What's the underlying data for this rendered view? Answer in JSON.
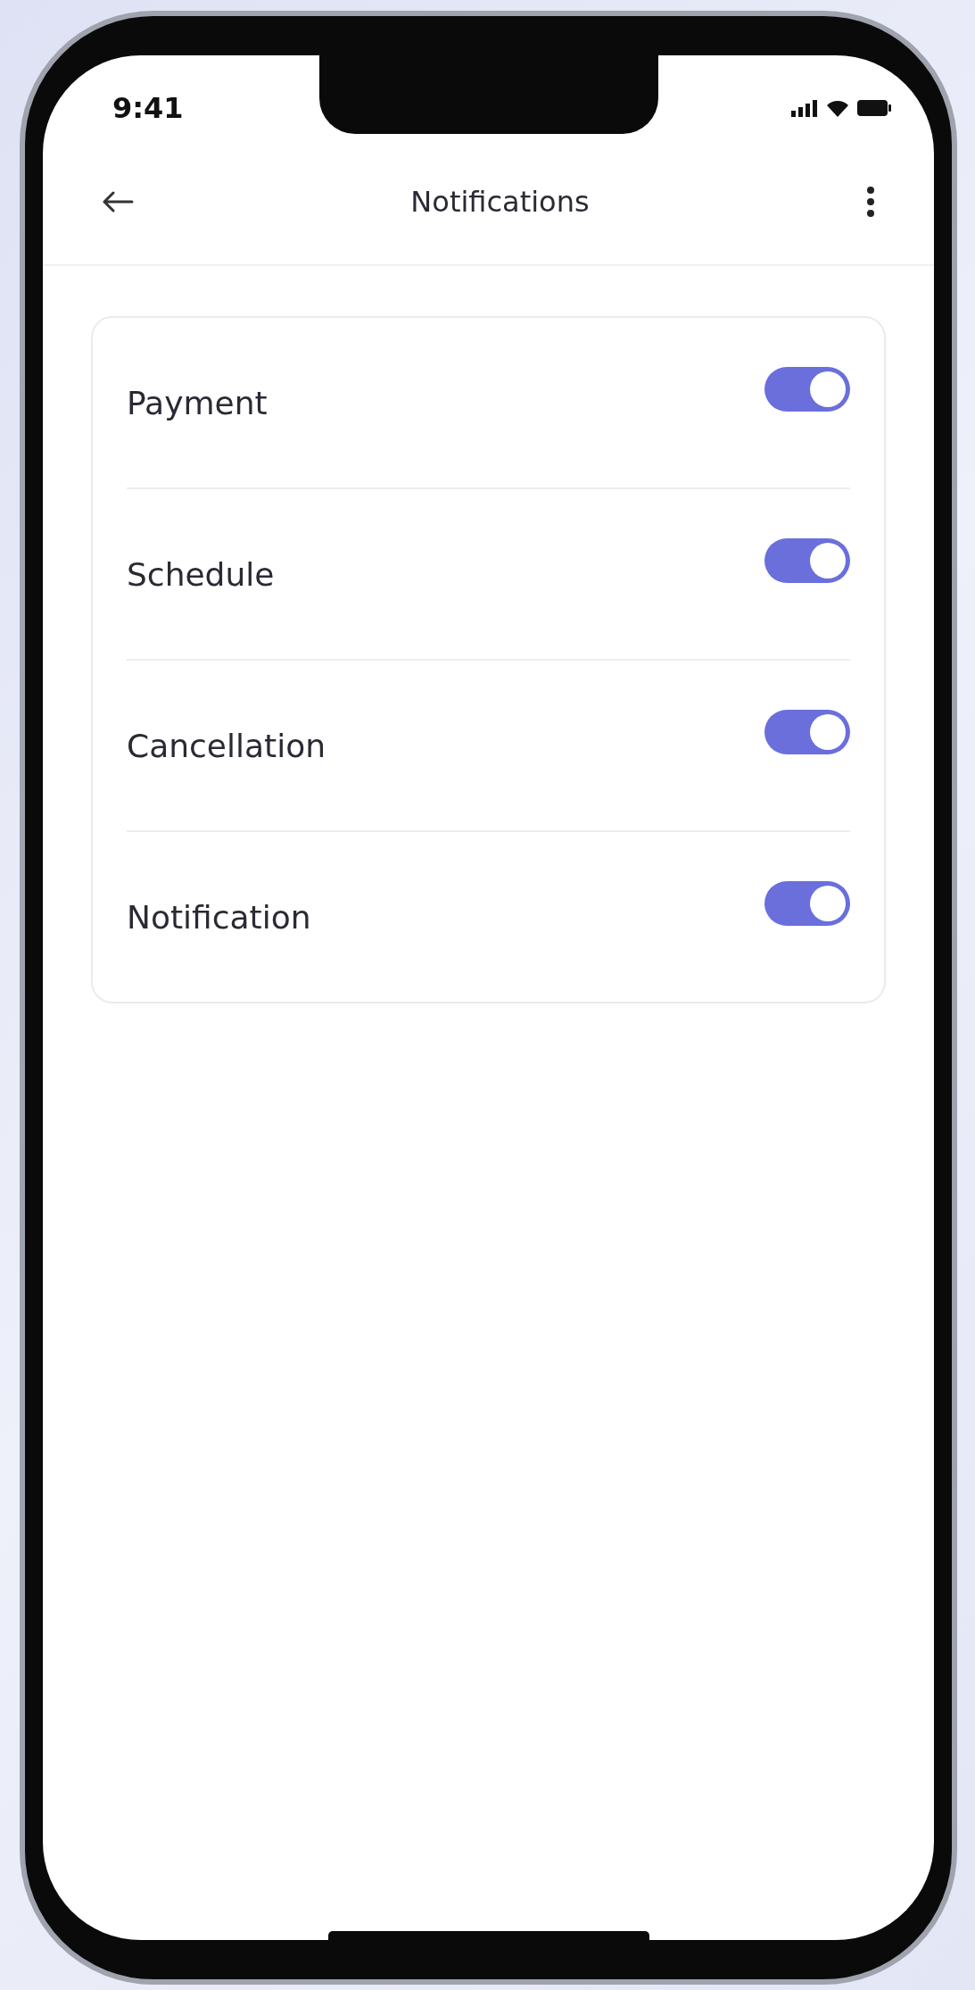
{
  "status_bar": {
    "time": "9:41"
  },
  "header": {
    "title": "Notifications"
  },
  "settings": [
    {
      "label": "Payment",
      "on": true
    },
    {
      "label": "Schedule",
      "on": true
    },
    {
      "label": "Cancellation",
      "on": true
    },
    {
      "label": "Notification",
      "on": true
    }
  ]
}
